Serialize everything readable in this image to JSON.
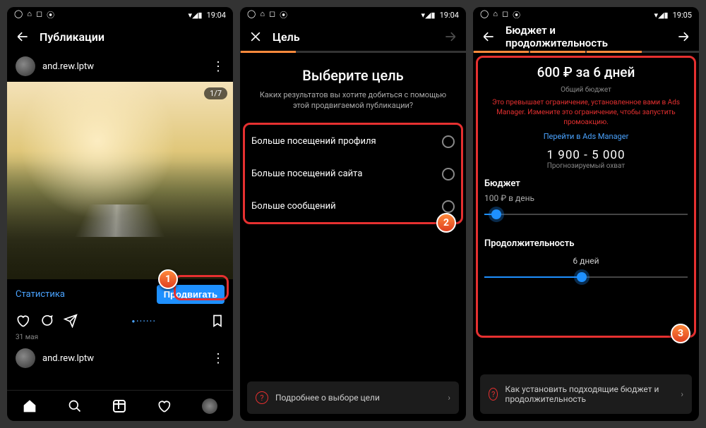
{
  "status": {
    "time1": "19:04",
    "time2": "19:04",
    "time3": "19:05"
  },
  "s1": {
    "title": "Публикации",
    "user": "and.rew.lptw",
    "counter": "1/7",
    "stats": "Статистика",
    "promote": "Продвигать",
    "date": "31 мая"
  },
  "s2": {
    "title": "Цель",
    "heading": "Выберите цель",
    "sub": "Каких результатов вы хотите добиться с помощью этой продвигаемой публикации?",
    "opt1": "Больше посещений профиля",
    "opt2": "Больше посещений сайта",
    "opt3": "Больше сообщений",
    "helper": "Подробнее о выборе цели"
  },
  "s3": {
    "title": "Бюджет и продолжительность",
    "summary": "600 ₽ за 6 дней",
    "summary_sub": "Общий бюджет",
    "warn": "Это превышает ограничение, установленное вами в Ads Manager. Измените это ограничение, чтобы запустить промоакцию.",
    "link": "Перейти в Ads Manager",
    "reach": "1 900 - 5 000",
    "reach_sub": "Прогнозируемый охват",
    "budget_label": "Бюджет",
    "budget_val": "100 ₽ в день",
    "duration_label": "Продолжительность",
    "duration_val": "6 дней",
    "helper": "Как установить подходящие бюджет и продолжительность"
  },
  "steps": {
    "n1": "1",
    "n2": "2",
    "n3": "3"
  }
}
